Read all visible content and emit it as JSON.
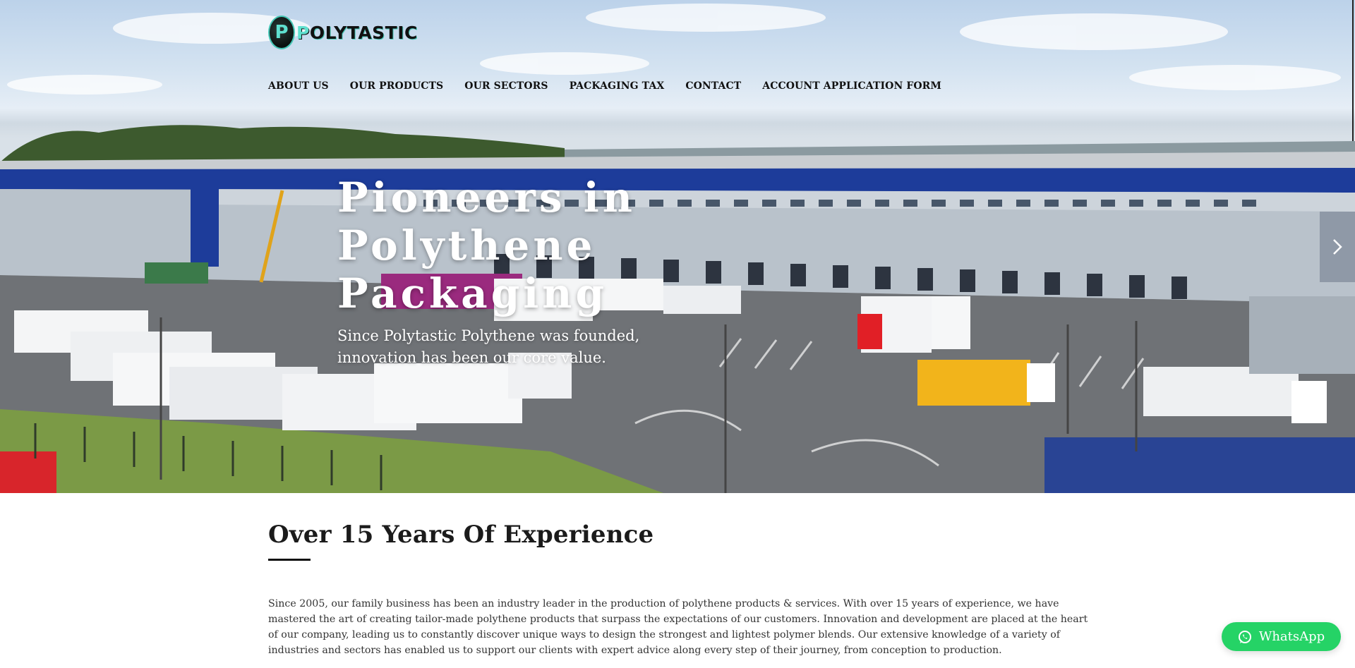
{
  "brand": {
    "logo_text_a": "P",
    "logo_text_b": "OLYTASTIC"
  },
  "nav": [
    {
      "label": "ABOUT US"
    },
    {
      "label": "OUR PRODUCTS"
    },
    {
      "label": "OUR SECTORS"
    },
    {
      "label": "PACKAGING TAX"
    },
    {
      "label": "CONTACT"
    },
    {
      "label": "ACCOUNT APPLICATION FORM"
    }
  ],
  "hero": {
    "title": "Pioneers in Polythene Packaging",
    "subtitle": "Since Polytastic Polythene was founded, innovation has been our core value.",
    "next_icon": "chevron-right-icon"
  },
  "about": {
    "title": "Over 15 Years Of Experience",
    "body": "Since 2005, our family business has been an industry leader in the production of polythene products & services. With over 15 years of experience, we have mastered the art of creating tailor-made polythene products that surpass the expectations of our customers. Innovation and development are placed at the heart of our company, leading us to constantly discover unique ways to design the strongest and lightest polymer blends. Our extensive knowledge of a variety of industries and sectors has enabled us to support our clients with expert advice along every step of their journey, from conception to production."
  },
  "whatsapp": {
    "label": "WhatsApp",
    "icon": "whatsapp-icon"
  },
  "colors": {
    "accent": "#25d366",
    "logo_teal": "#46c7b6",
    "warehouse_blue": "#1d3c9a"
  }
}
